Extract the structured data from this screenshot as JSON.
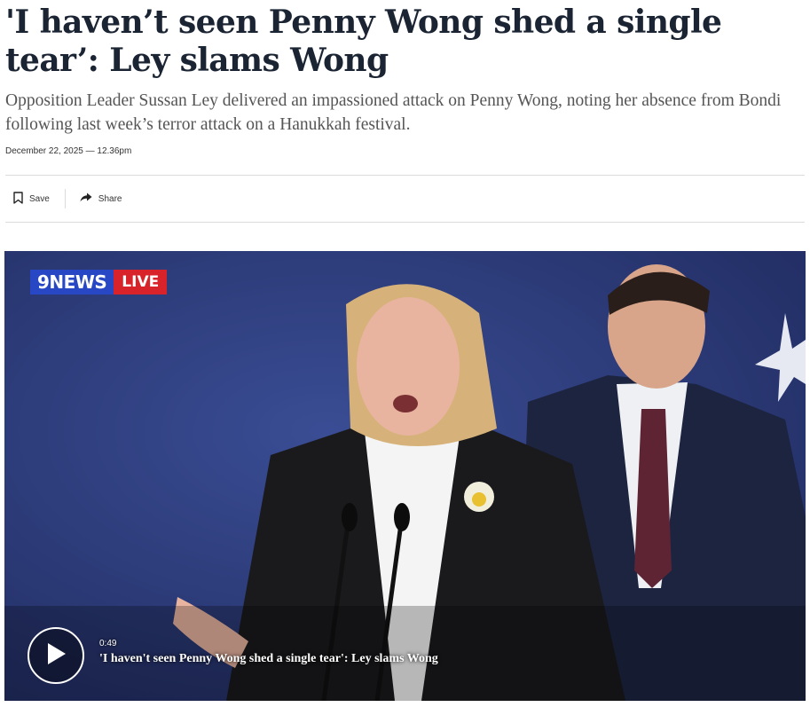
{
  "article": {
    "headline": "'I haven’t seen Penny Wong shed a single tear’: Ley slams Wong",
    "standfirst": "Opposition Leader Sussan Ley delivered an impassioned attack on Penny Wong, noting her absence from Bondi following last week’s terror attack on a Hanukkah festival.",
    "dateline": "December 22, 2025 — 12.36pm"
  },
  "actions": {
    "save_label": "Save",
    "share_label": "Share",
    "save_icon": "bookmark-icon",
    "share_icon": "share-arrow-icon"
  },
  "video": {
    "channel_logo": "9NEWS",
    "live_badge": "LIVE",
    "duration": "0:49",
    "title": "'I haven't seen Penny Wong shed a single tear': Ley slams Wong",
    "play_icon": "play-icon",
    "colors": {
      "background": "#2d3f7e",
      "news_blue": "#2747c4",
      "live_red": "#d8232a"
    }
  }
}
